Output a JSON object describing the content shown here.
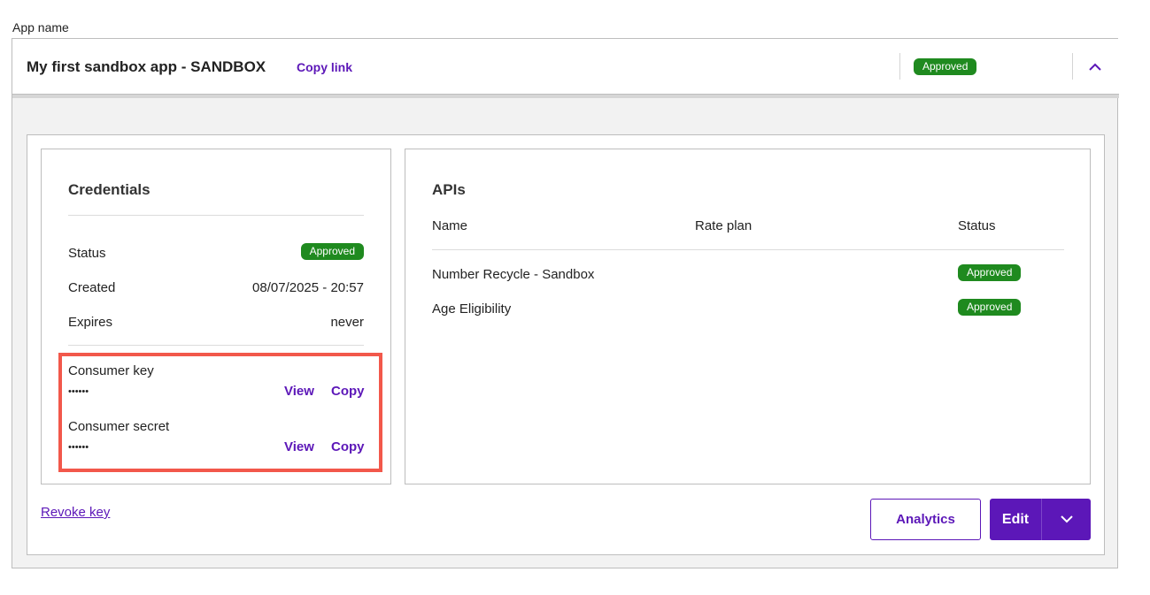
{
  "app_label": "App name",
  "header": {
    "app_title": "My first sandbox app - SANDBOX",
    "copy_link": "Copy link",
    "status_badge": "Approved"
  },
  "credentials": {
    "title": "Credentials",
    "rows": [
      {
        "label": "Status",
        "badge": "Approved"
      },
      {
        "label": "Created",
        "value": "08/07/2025 - 20:57"
      },
      {
        "label": "Expires",
        "value": "never"
      }
    ],
    "consumer_key": {
      "label": "Consumer key",
      "masked": "••••••",
      "view": "View",
      "copy": "Copy"
    },
    "consumer_secret": {
      "label": "Consumer secret",
      "masked": "••••••",
      "view": "View",
      "copy": "Copy"
    }
  },
  "apis": {
    "title": "APIs",
    "columns": [
      "Name",
      "Rate plan",
      "Status"
    ],
    "rows": [
      {
        "name": "Number Recycle - Sandbox",
        "rate_plan": "",
        "status": "Approved"
      },
      {
        "name": "Age Eligibility",
        "rate_plan": "",
        "status": "Approved"
      }
    ]
  },
  "actions": {
    "revoke_key": "Revoke key",
    "analytics": "Analytics",
    "edit": "Edit"
  },
  "icons": {
    "collapse": "chevron-up-icon",
    "edit_menu": "chevron-down-icon"
  },
  "colors": {
    "accent": "#5c17b8",
    "approved": "#1f8a1f",
    "highlight": "#f2584b"
  }
}
